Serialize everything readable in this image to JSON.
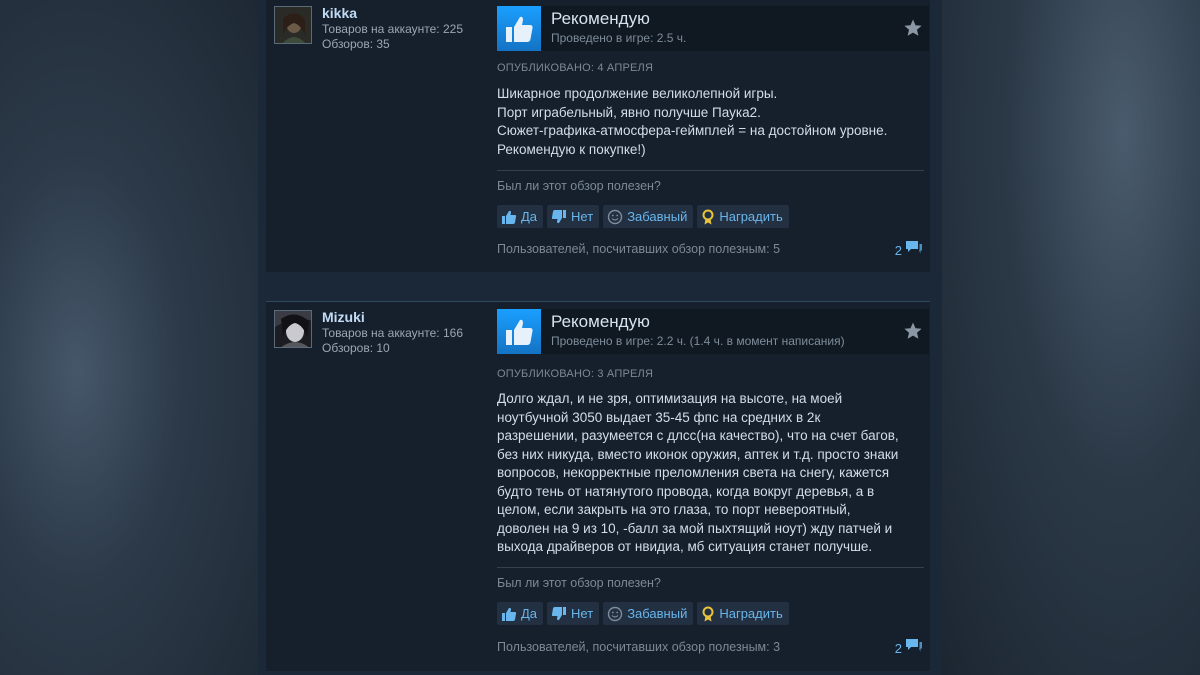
{
  "reviews": [
    {
      "author": "kikka",
      "products": "Товаров на аккаунте: 225",
      "reviews_count": "Обзоров: 35",
      "verdict": "Рекомендую",
      "hours": "Проведено в игре: 2.5 ч.",
      "posted": "ОПУБЛИКОВАНО: 4 АПРЕЛЯ",
      "text_lines": [
        "Шикарное продолжение великолепной игры.",
        "Порт играбельный, явно получше Паука2.",
        "Сюжет-графика-атмосфера-геймплей = на достойном уровне.",
        "Рекомендую к покупке!)"
      ],
      "helpful_question": "Был ли этот обзор полезен?",
      "buttons": {
        "yes": "Да",
        "no": "Нет",
        "funny": "Забавный",
        "award": "Наградить"
      },
      "helpful_count": "Пользователей, посчитавших обзор полезным: 5",
      "comments": "2"
    },
    {
      "author": "Mizuki",
      "products": "Товаров на аккаунте: 166",
      "reviews_count": "Обзоров: 10",
      "verdict": "Рекомендую",
      "hours": "Проведено в игре: 2.2 ч. (1.4 ч. в момент написания)",
      "posted": "ОПУБЛИКОВАНО: 3 АПРЕЛЯ",
      "text_lines": [
        "Долго ждал, и не зря, оптимизация на высоте, на моей",
        "ноутбучной 3050 выдает 35-45 фпс на средних в 2к",
        "разрешении, разумеется с длсс(на качество), что на счет багов,",
        "без них никуда, вместо иконок оружия, аптек и т.д. просто знаки",
        "вопросов, некорректные преломления света на снегу, кажется",
        "будто тень от натянутого провода, когда вокруг деревья, а в",
        "целом, если закрыть на это глаза, то порт невероятный,",
        "доволен на 9 из 10, -балл за мой пыхтящий ноут) жду патчей и",
        "выхода драйверов от нвидиа, мб ситуация станет получше."
      ],
      "helpful_question": "Был ли этот обзор полезен?",
      "buttons": {
        "yes": "Да",
        "no": "Нет",
        "funny": "Забавный",
        "award": "Наградить"
      },
      "helpful_count": "Пользователей, посчитавших обзор полезным: 3",
      "comments": "2"
    }
  ],
  "icons": {
    "thumb": "thumbs-up-icon",
    "star": "star-icon",
    "yes": "thumb-up-small-icon",
    "no": "thumb-down-small-icon",
    "funny": "smiley-icon",
    "award": "award-icon",
    "comments": "comment-bubble-icon"
  },
  "colors": {
    "accent": "#1a9fff",
    "link": "#68b6ed",
    "name": "#c1dbf4",
    "award": "#e8c33b"
  }
}
